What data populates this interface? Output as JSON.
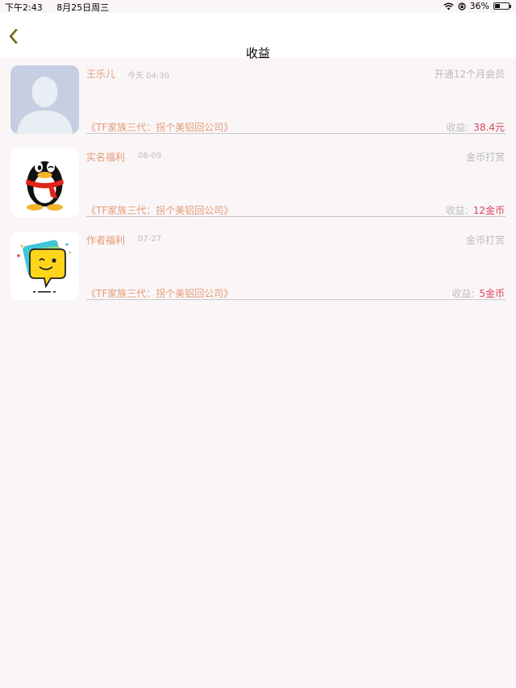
{
  "status_bar": {
    "time": "下午2:43",
    "date": "8月25日周三",
    "battery": "36%",
    "battery_level": 0.36,
    "icons": [
      "wifi-icon",
      "orientation-lock-icon",
      "battery-icon"
    ]
  },
  "nav": {
    "title": "收益",
    "back_icon": "chevron-left-icon"
  },
  "colors": {
    "accent": "#e59a74",
    "amount": "#d9465a",
    "muted": "#bcbcbc",
    "background": "#faf6f8"
  },
  "income_label": "收益:",
  "entries": [
    {
      "avatar": "default-user-avatar",
      "name": "王乐儿",
      "date": "今天 04:30",
      "type": "开通12个月会员",
      "book": "《TF家族三代：拐个美铝回公司》",
      "amount": "38.4元"
    },
    {
      "avatar": "qq-penguin-avatar",
      "name": "实名福利",
      "date": "08-09",
      "type": "金币打赏",
      "book": "《TF家族三代：拐个美铝回公司》",
      "amount": "12金币"
    },
    {
      "avatar": "chat-bubble-face-avatar",
      "name": "作者福利",
      "date": "07-27",
      "type": "金币打赏",
      "book": "《TF家族三代：拐个美铝回公司》",
      "amount": "5金币"
    }
  ]
}
